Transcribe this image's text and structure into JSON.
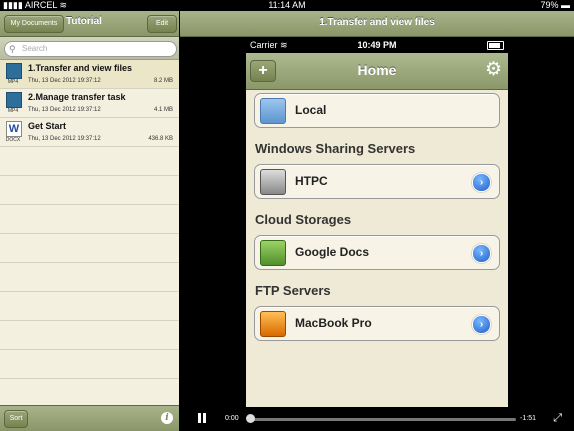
{
  "status_bar": {
    "carrier": "AIRCEL",
    "time": "11:14 AM",
    "battery": "79%"
  },
  "left_pane": {
    "back_button": "My Documents",
    "title": "Tutorial",
    "edit_button": "Edit",
    "search_placeholder": "Search",
    "files": [
      {
        "name": "1.Transfer and view files",
        "date": "Thu, 13 Dec 2012 19:37:12",
        "size": "8.2 MB",
        "type": "MP4",
        "icon": "video-icon",
        "selected": true
      },
      {
        "name": "2.Manage transfer task",
        "date": "Thu, 13 Dec 2012 19:37:12",
        "size": "4.1 MB",
        "type": "MP4",
        "icon": "video-icon",
        "selected": false
      },
      {
        "name": "Get Start",
        "date": "Thu, 13 Dec 2012 19:37:12",
        "size": "436.8 KB",
        "type": "DOCX",
        "icon": "word-doc-icon",
        "selected": false
      }
    ],
    "sort_button": "Sort",
    "info_glyph": "i"
  },
  "right_pane": {
    "title": "1.Transfer and view files",
    "phone": {
      "carrier": "Carrier",
      "time": "10:49 PM",
      "add_glyph": "+",
      "title": "Home",
      "local_label": "Local",
      "sections": {
        "windows": "Windows Sharing Servers",
        "cloud": "Cloud Storages",
        "ftp": "FTP Servers"
      },
      "items": {
        "htpc": "HTPC",
        "google": "Google Docs",
        "macbook": "MacBook Pro"
      }
    },
    "player": {
      "current_time": "0:00",
      "remaining_time": "-1:51",
      "progress": 0.0
    }
  },
  "colors": {
    "bar_olive": "#8a9668",
    "pane_bg": "#f3efdf",
    "phone_bg": "#efead5",
    "disclosure_blue": "#1f5fc7"
  }
}
